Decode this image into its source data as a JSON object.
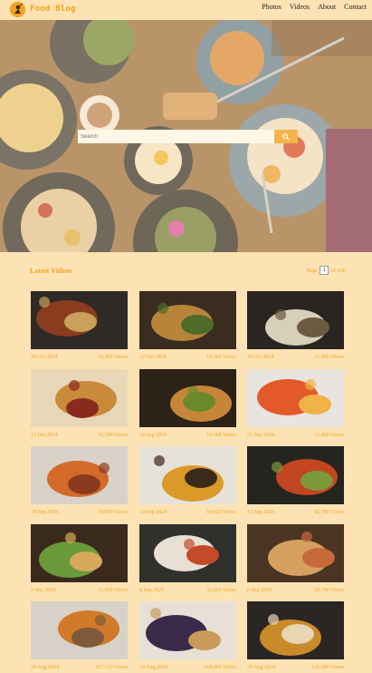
{
  "header": {
    "title": "Food Blog",
    "logo_icon": "chef-mascot-icon",
    "nav": [
      "Photos",
      "Videos",
      "About",
      "Contact"
    ]
  },
  "hero": {
    "search_placeholder": "Search",
    "search_icon": "search-icon"
  },
  "latest": {
    "title": "Latest Videos",
    "page_label": "Page",
    "page_current": "1",
    "page_total": "of 100"
  },
  "videos": [
    {
      "date": "24 Oct 2024",
      "views": "10,469 Views"
    },
    {
      "date": "22 Oct 2024",
      "views": "14,302 Views"
    },
    {
      "date": "18 Oct 2024",
      "views": "11,906 Views"
    },
    {
      "date": "12 Oct 2024",
      "views": "16,100 Views"
    },
    {
      "date": "24 Sep 2024",
      "views": "16,008 Views"
    },
    {
      "date": "21 Sep 2024",
      "views": "12,860 Views"
    },
    {
      "date": "18 Sep 2024",
      "views": "10,900 Views"
    },
    {
      "date": "14 Sep 2024",
      "views": "10,820 Views"
    },
    {
      "date": "12 Sep 2024",
      "views": "42,700 Views"
    },
    {
      "date": "9 Sep 2024",
      "views": "11,420 Views"
    },
    {
      "date": "8 Sep 2024",
      "views": "32,006 Views"
    },
    {
      "date": "6 Sep 2024",
      "views": "50,700 Views"
    },
    {
      "date": "28 Aug 2024",
      "views": "107,510 Views"
    },
    {
      "date": "24 Aug 2024",
      "views": "118,000 Views"
    },
    {
      "date": "20 Aug 2024",
      "views": "121,300 Views"
    }
  ],
  "colors": {
    "accent": "#f49e1a",
    "background": "#fde3b4"
  }
}
